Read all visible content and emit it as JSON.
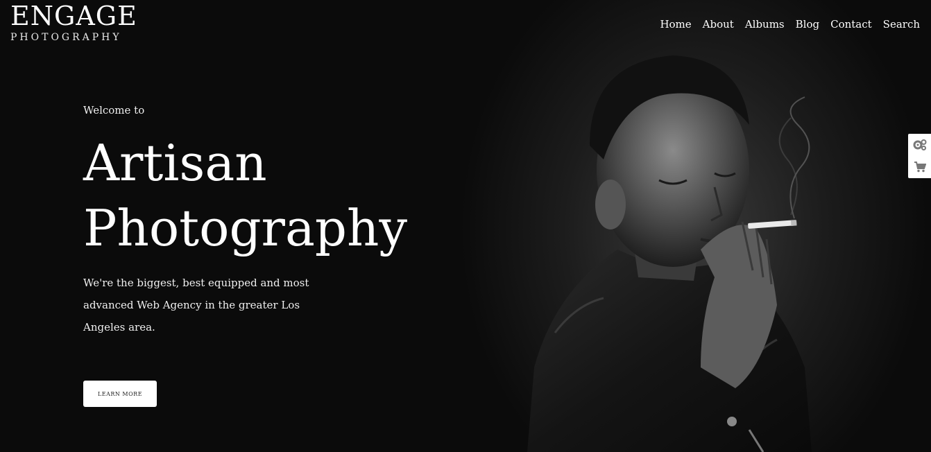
{
  "logo": {
    "main": "ENGAGE",
    "sub": "PHOTOGRAPHY"
  },
  "nav": {
    "items": [
      {
        "label": "Home"
      },
      {
        "label": "About"
      },
      {
        "label": "Albums"
      },
      {
        "label": "Blog"
      },
      {
        "label": "Contact"
      },
      {
        "label": "Search"
      }
    ]
  },
  "hero": {
    "welcome": "Welcome to",
    "title_line1": "Artisan",
    "title_line2": "Photography",
    "description": "We're the biggest, best equipped and most advanced Web Agency in the greater Los Angeles area.",
    "button_label": "LEARN MORE",
    "image_icon": "portrait-photo"
  },
  "side_panel": {
    "icons": [
      "gears-icon",
      "cart-icon"
    ]
  },
  "colors": {
    "background": "#0b0b0b",
    "text": "#ffffff",
    "button_bg": "#ffffff",
    "button_text": "#222222",
    "side_icon": "#777777"
  }
}
